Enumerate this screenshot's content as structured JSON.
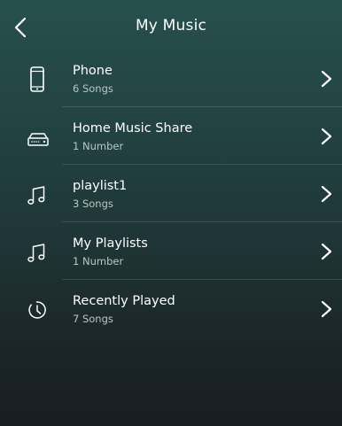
{
  "header": {
    "title": "My Music"
  },
  "items": [
    {
      "label": "Phone",
      "sub": "6 Songs",
      "icon": "phone-icon"
    },
    {
      "label": "Home Music Share",
      "sub": "1 Number",
      "icon": "router-icon"
    },
    {
      "label": "playlist1",
      "sub": "3 Songs",
      "icon": "music-note-icon"
    },
    {
      "label": "My Playlists",
      "sub": "1 Number",
      "icon": "music-note-icon"
    },
    {
      "label": "Recently Played",
      "sub": "7 Songs",
      "icon": "history-clock-icon"
    }
  ]
}
